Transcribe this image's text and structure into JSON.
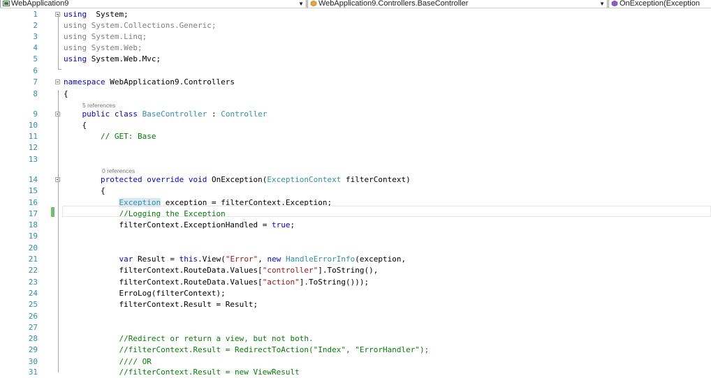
{
  "navbar": {
    "project": "WebApplication9",
    "class": "WebApplication9.Controllers.BaseController",
    "member": "OnException(Exception"
  },
  "colors": {
    "keyword": "#0000ff",
    "type": "#2b91af",
    "string": "#a31515",
    "comment": "#008000",
    "line_number": "#2b91af",
    "change_bar": "#6cc16c"
  },
  "lines": [
    {
      "n": "1",
      "tokens": [
        [
          "kw",
          "using"
        ],
        [
          "",
          "  System;"
        ]
      ]
    },
    {
      "n": "2",
      "tokens": [
        [
          "gray",
          "using System.Collections.Generic;"
        ]
      ]
    },
    {
      "n": "3",
      "tokens": [
        [
          "gray",
          "using System.Linq;"
        ]
      ]
    },
    {
      "n": "4",
      "tokens": [
        [
          "gray",
          "using System.Web;"
        ]
      ]
    },
    {
      "n": "5",
      "tokens": [
        [
          "kw",
          "using"
        ],
        [
          "",
          " System.Web.Mvc;"
        ]
      ]
    },
    {
      "n": "6",
      "tokens": []
    },
    {
      "n": "7",
      "tokens": [
        [
          "kw",
          "namespace"
        ],
        [
          "",
          " WebApplication9.Controllers"
        ]
      ]
    },
    {
      "n": "8",
      "tokens": [
        [
          "",
          "{"
        ]
      ]
    },
    {
      "n": "9",
      "lens": "5 references",
      "tokens": [
        [
          "",
          "    "
        ],
        [
          "kw",
          "public"
        ],
        [
          "",
          " "
        ],
        [
          "kw",
          "class"
        ],
        [
          "",
          " "
        ],
        [
          "ty",
          "BaseController"
        ],
        [
          "",
          " : "
        ],
        [
          "ty",
          "Controller"
        ]
      ]
    },
    {
      "n": "10",
      "tokens": [
        [
          "",
          "    {"
        ]
      ]
    },
    {
      "n": "11",
      "tokens": [
        [
          "",
          "        "
        ],
        [
          "cm",
          "// GET: Base"
        ]
      ]
    },
    {
      "n": "12",
      "tokens": []
    },
    {
      "n": "13",
      "tokens": []
    },
    {
      "n": "14",
      "lens": "0 references",
      "tokens": [
        [
          "",
          "        "
        ],
        [
          "kw",
          "protected"
        ],
        [
          "",
          " "
        ],
        [
          "kw",
          "override"
        ],
        [
          "",
          " "
        ],
        [
          "kw",
          "void"
        ],
        [
          "",
          " OnException("
        ],
        [
          "ty",
          "ExceptionContext"
        ],
        [
          "",
          " filterContext)"
        ]
      ]
    },
    {
      "n": "15",
      "tokens": [
        [
          "",
          "        {"
        ]
      ]
    },
    {
      "n": "16",
      "tokens": [
        [
          "",
          "            "
        ],
        [
          "ty hl",
          "Exception"
        ],
        [
          "",
          " exception = filterContext.Exception;"
        ]
      ]
    },
    {
      "n": "17",
      "tokens": [
        [
          "",
          "            "
        ],
        [
          "cm",
          "//Logging the Exception"
        ]
      ]
    },
    {
      "n": "18",
      "tokens": [
        [
          "",
          "            filterContext.ExceptionHandled = "
        ],
        [
          "kw",
          "true"
        ],
        [
          "",
          ";"
        ]
      ]
    },
    {
      "n": "19",
      "tokens": []
    },
    {
      "n": "20",
      "tokens": []
    },
    {
      "n": "21",
      "tokens": [
        [
          "",
          "            "
        ],
        [
          "kw",
          "var"
        ],
        [
          "",
          " Result = "
        ],
        [
          "kw",
          "this"
        ],
        [
          "",
          ".View("
        ],
        [
          "str",
          "\"Error\""
        ],
        [
          "",
          ", "
        ],
        [
          "kw",
          "new"
        ],
        [
          "",
          " "
        ],
        [
          "ty",
          "HandleErrorInfo"
        ],
        [
          "",
          "(exception,"
        ]
      ]
    },
    {
      "n": "22",
      "tokens": [
        [
          "",
          "            filterContext.RouteData.Values["
        ],
        [
          "str",
          "\"controller\""
        ],
        [
          "",
          "].ToString(),"
        ]
      ]
    },
    {
      "n": "23",
      "tokens": [
        [
          "",
          "            filterContext.RouteData.Values["
        ],
        [
          "str",
          "\"action\""
        ],
        [
          "",
          "].ToString()));"
        ]
      ]
    },
    {
      "n": "24",
      "tokens": [
        [
          "",
          "            ErroLog(filterContext);"
        ]
      ]
    },
    {
      "n": "25",
      "tokens": [
        [
          "",
          "            filterContext.Result = Result;"
        ]
      ]
    },
    {
      "n": "26",
      "tokens": []
    },
    {
      "n": "27",
      "tokens": []
    },
    {
      "n": "28",
      "tokens": [
        [
          "",
          "            "
        ],
        [
          "cm",
          "//Redirect or return a view, but not both."
        ]
      ]
    },
    {
      "n": "29",
      "tokens": [
        [
          "",
          "            "
        ],
        [
          "cm",
          "//filterContext.Result = RedirectToAction(\"Index\", \"ErrorHandler\");"
        ]
      ]
    },
    {
      "n": "30",
      "tokens": [
        [
          "",
          "            "
        ],
        [
          "cm",
          "//// OR"
        ]
      ]
    },
    {
      "n": "31",
      "tokens": [
        [
          "",
          "            "
        ],
        [
          "cm",
          "//filterContext.Result = new ViewResult"
        ]
      ]
    }
  ]
}
